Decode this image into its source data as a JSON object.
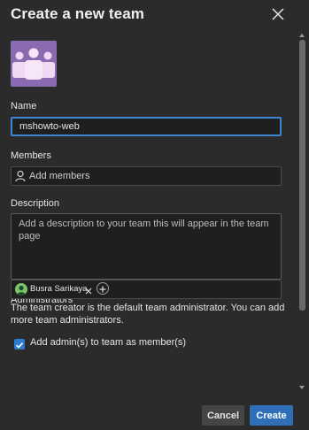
{
  "dialog": {
    "title": "Create a new team",
    "close_icon": "close-icon"
  },
  "form": {
    "name_label": "Name",
    "name_value": "mshowto-web",
    "members_label": "Members",
    "members_placeholder": "Add members",
    "description_label": "Description",
    "description_placeholder": "Add a description to your team this will appear in the team page",
    "administrators_label": "Administrators",
    "admin_chip_name": "Busra Sarikaya",
    "admin_help_text": "The team creator is the default team administrator. You can add more team administrators.",
    "add_admins_checkbox_label": "Add admin(s) to team as member(s)",
    "add_admins_checked": true
  },
  "buttons": {
    "cancel_label": "Cancel",
    "create_label": "Create"
  },
  "colors": {
    "background": "#2b2b2b",
    "accent": "#2f6fb8",
    "team_avatar": "#8a6ab0"
  }
}
